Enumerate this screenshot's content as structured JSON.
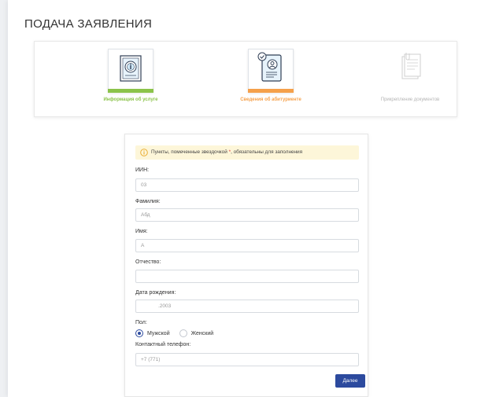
{
  "page": {
    "title": "ПОДАЧА ЗАЯВЛЕНИЯ"
  },
  "steps": [
    {
      "label": "Информация об услуге",
      "icon": "info-document-icon",
      "state": "done",
      "color": "#8bc34a"
    },
    {
      "label": "Сведения об абитуриенте",
      "icon": "applicant-profile-icon",
      "state": "active",
      "color": "#f5a04a"
    },
    {
      "label": "Прикрепление документов",
      "icon": "attach-documents-icon",
      "state": "pending",
      "color": "#b5b5b5"
    }
  ],
  "form": {
    "notice": {
      "before": "Пункты, помеченные звездочкой ",
      "star": "*",
      "after": ", обязательны для заполнения",
      "icon": "info-circle-icon"
    },
    "fields": {
      "iin": {
        "label": "ИИН:",
        "value": "03"
      },
      "lastname": {
        "label": "Фамилия:",
        "value": "Абд"
      },
      "firstname": {
        "label": "Имя:",
        "value": "А"
      },
      "patronymic": {
        "label": "Отчество:",
        "value": ""
      },
      "birthdate": {
        "label": "Дата рождения:",
        "value": ".2003"
      },
      "phone": {
        "label": "Контактный телефон:",
        "value": "+7 (771)"
      }
    },
    "gender": {
      "label": "Пол:",
      "options": [
        "Мужской",
        "Женский"
      ],
      "selected": "Мужской"
    },
    "next_label": "Далее"
  },
  "colors": {
    "primary": "#2c4a9e",
    "step_done": "#8bc34a",
    "step_active": "#f5a04a",
    "notice_bg": "#fdf6d9",
    "required_star": "#e53935"
  }
}
